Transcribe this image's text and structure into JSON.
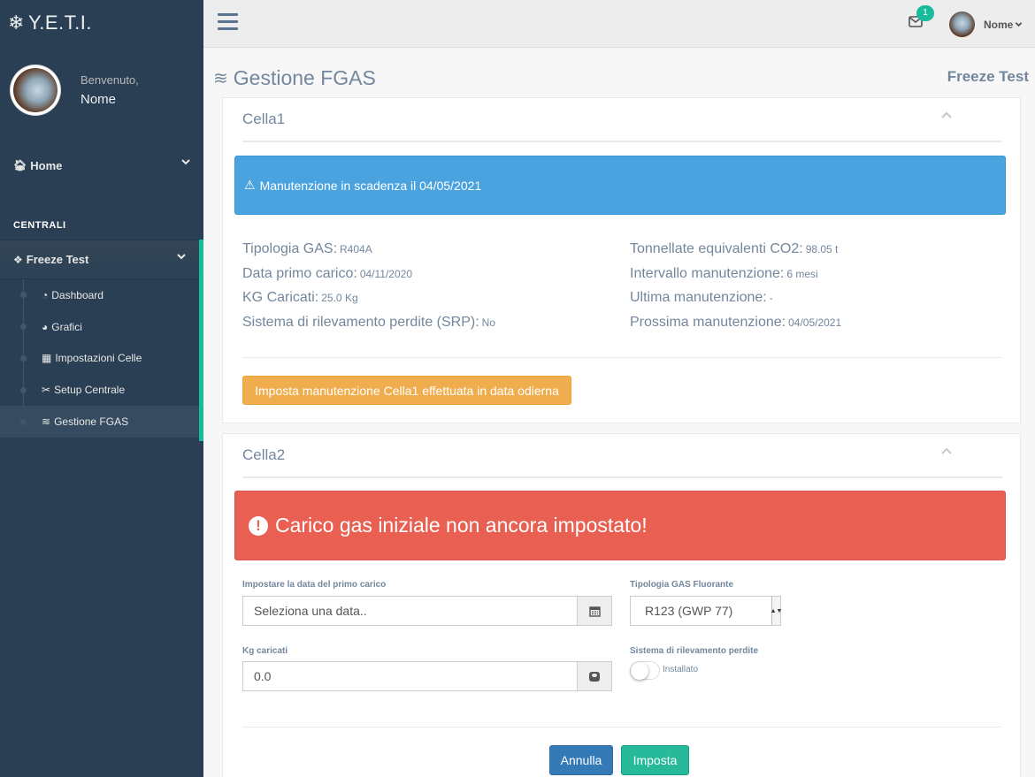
{
  "brand": {
    "title": "Y.E.T.I.",
    "icon": "snowflake-icon"
  },
  "profile": {
    "welcome": "Benvenuto,",
    "name": "Nome"
  },
  "sidebar": {
    "home_label": "Home",
    "section_title": "CENTRALI",
    "group_label": "Freeze Test",
    "items": [
      {
        "label": "Dashboard",
        "icon": "dashboard-icon"
      },
      {
        "label": "Grafici",
        "icon": "pie-chart-icon"
      },
      {
        "label": "Impostazioni Celle",
        "icon": "grid-icon"
      },
      {
        "label": "Setup Centrale",
        "icon": "wrench-icon"
      },
      {
        "label": "Gestione FGAS",
        "icon": "wind-icon"
      }
    ]
  },
  "topbar": {
    "mail_badge": "1",
    "user_name": "Nome"
  },
  "page": {
    "title": "Gestione FGAS",
    "right_label": "Freeze Test"
  },
  "cella1": {
    "title": "Cella1",
    "alert": "Manutenzione in scadenza il 04/05/2021",
    "left": [
      {
        "label": "Tipologia GAS:",
        "value": "R404A"
      },
      {
        "label": "Data primo carico:",
        "value": "04/11/2020"
      },
      {
        "label": "KG Caricati:",
        "value": "25.0 Kg"
      },
      {
        "label": "Sistema di rilevamento perdite (SRP):",
        "value": "No"
      }
    ],
    "right": [
      {
        "label": "Tonnellate equivalenti CO2:",
        "value": "98.05 t"
      },
      {
        "label": "Intervallo manutenzione:",
        "value": "6 mesi"
      },
      {
        "label": "Ultima manutenzione:",
        "value": "-"
      },
      {
        "label": "Prossima manutenzione:",
        "value": "04/05/2021"
      }
    ],
    "button": "Imposta manutenzione Cella1 effettuata in data odierna"
  },
  "cella2": {
    "title": "Cella2",
    "alert": "Carico gas iniziale non ancora impostato!",
    "date_label": "Impostare la data del primo carico",
    "date_placeholder": "Seleziona una data..",
    "gas_label": "Tipologia GAS Fluorante",
    "gas_selected": "R123 (GWP 77)",
    "kg_label": "Kg caricati",
    "kg_value": "0.0",
    "srp_label": "Sistema di rilevamento perdite",
    "srp_toggle_label": "Installato",
    "cancel": "Annulla",
    "submit": "Imposta"
  }
}
